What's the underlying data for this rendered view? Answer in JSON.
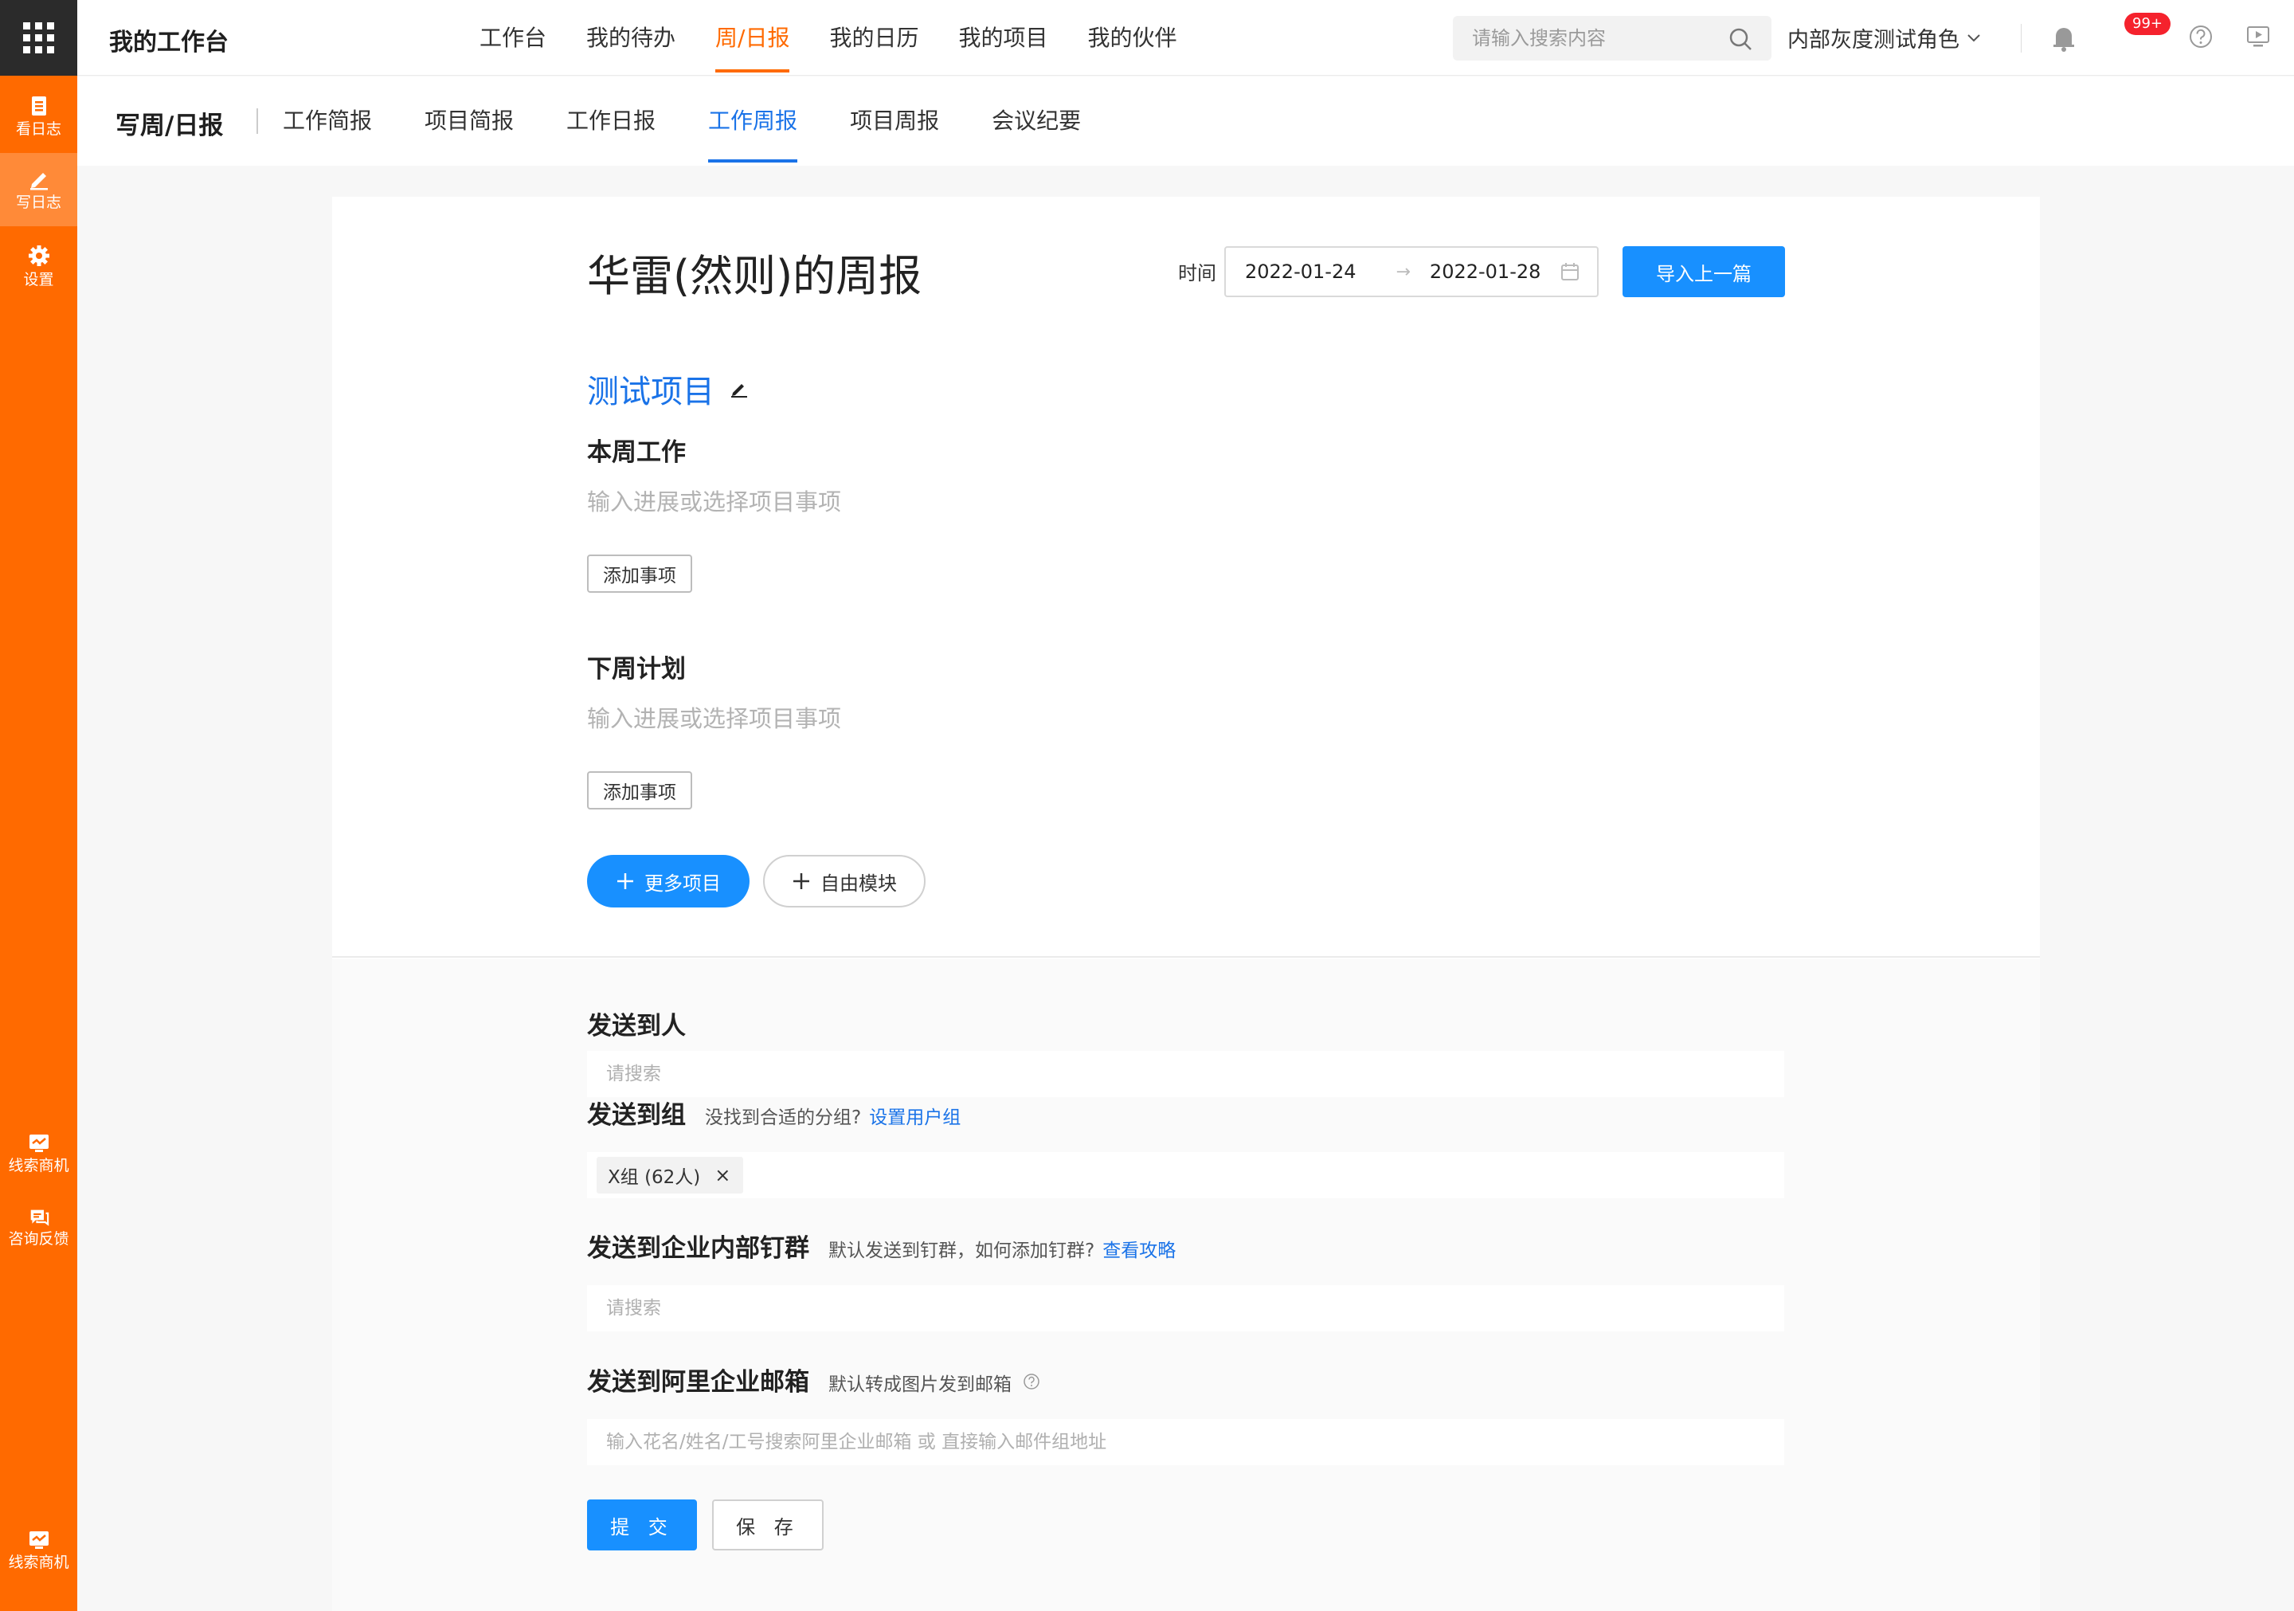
{
  "sidebar": {
    "items": [
      {
        "label": "看日志",
        "icon": "doc-icon"
      },
      {
        "label": "写日志",
        "icon": "pencil-icon"
      },
      {
        "label": "设置",
        "icon": "gear-icon"
      },
      {
        "label": "线索商机",
        "icon": "chart-monitor-icon"
      },
      {
        "label": "咨询反馈",
        "icon": "chat-icon"
      },
      {
        "label": "线索商机",
        "icon": "chart-monitor-icon"
      }
    ]
  },
  "header": {
    "title": "我的工作台",
    "nav": [
      "工作台",
      "我的待办",
      "周/日报",
      "我的日历",
      "我的项目",
      "我的伙伴"
    ],
    "active_nav": "周/日报",
    "search_placeholder": "请输入搜索内容",
    "role": "内部灰度测试角色",
    "notification_badge": "99+"
  },
  "subheader": {
    "title": "写周/日报",
    "tabs": [
      "工作简报",
      "项目简报",
      "工作日报",
      "工作周报",
      "项目周报",
      "会议纪要"
    ],
    "active_tab": "工作周报"
  },
  "report": {
    "title": "华雷(然则)的周报",
    "time_label": "时间",
    "date_start": "2022-01-24",
    "date_arrow": "→",
    "date_end": "2022-01-28",
    "import_button": "导入上一篇",
    "project_name": "测试项目",
    "this_week_heading": "本周工作",
    "this_week_placeholder": "输入进展或选择项目事项",
    "add_item_button": "添加事项",
    "next_week_heading": "下周计划",
    "next_week_placeholder": "输入进展或选择项目事项",
    "more_projects_button": "更多项目",
    "free_module_button": "自由模块"
  },
  "send": {
    "to_person": {
      "heading": "发送到人",
      "placeholder": "请搜索"
    },
    "to_group": {
      "heading": "发送到组",
      "hint": "没找到合适的分组?",
      "link": "设置用户组",
      "tag": "X组 (62人)"
    },
    "to_dingtalk": {
      "heading": "发送到企业内部钉群",
      "hint": "默认发送到钉群，如何添加钉群?",
      "link": "查看攻略",
      "placeholder": "请搜索"
    },
    "to_mail": {
      "heading": "发送到阿里企业邮箱",
      "hint": "默认转成图片发到邮箱",
      "placeholder": "输入花名/姓名/工号搜索阿里企业邮箱 或 直接输入邮件组地址"
    },
    "submit_button": "提 交",
    "save_button": "保 存"
  },
  "colors": {
    "sidebar": "#ff6a00",
    "primary": "#1890ff",
    "active_nav": "#ff6a00",
    "link": "#1a73e8"
  }
}
